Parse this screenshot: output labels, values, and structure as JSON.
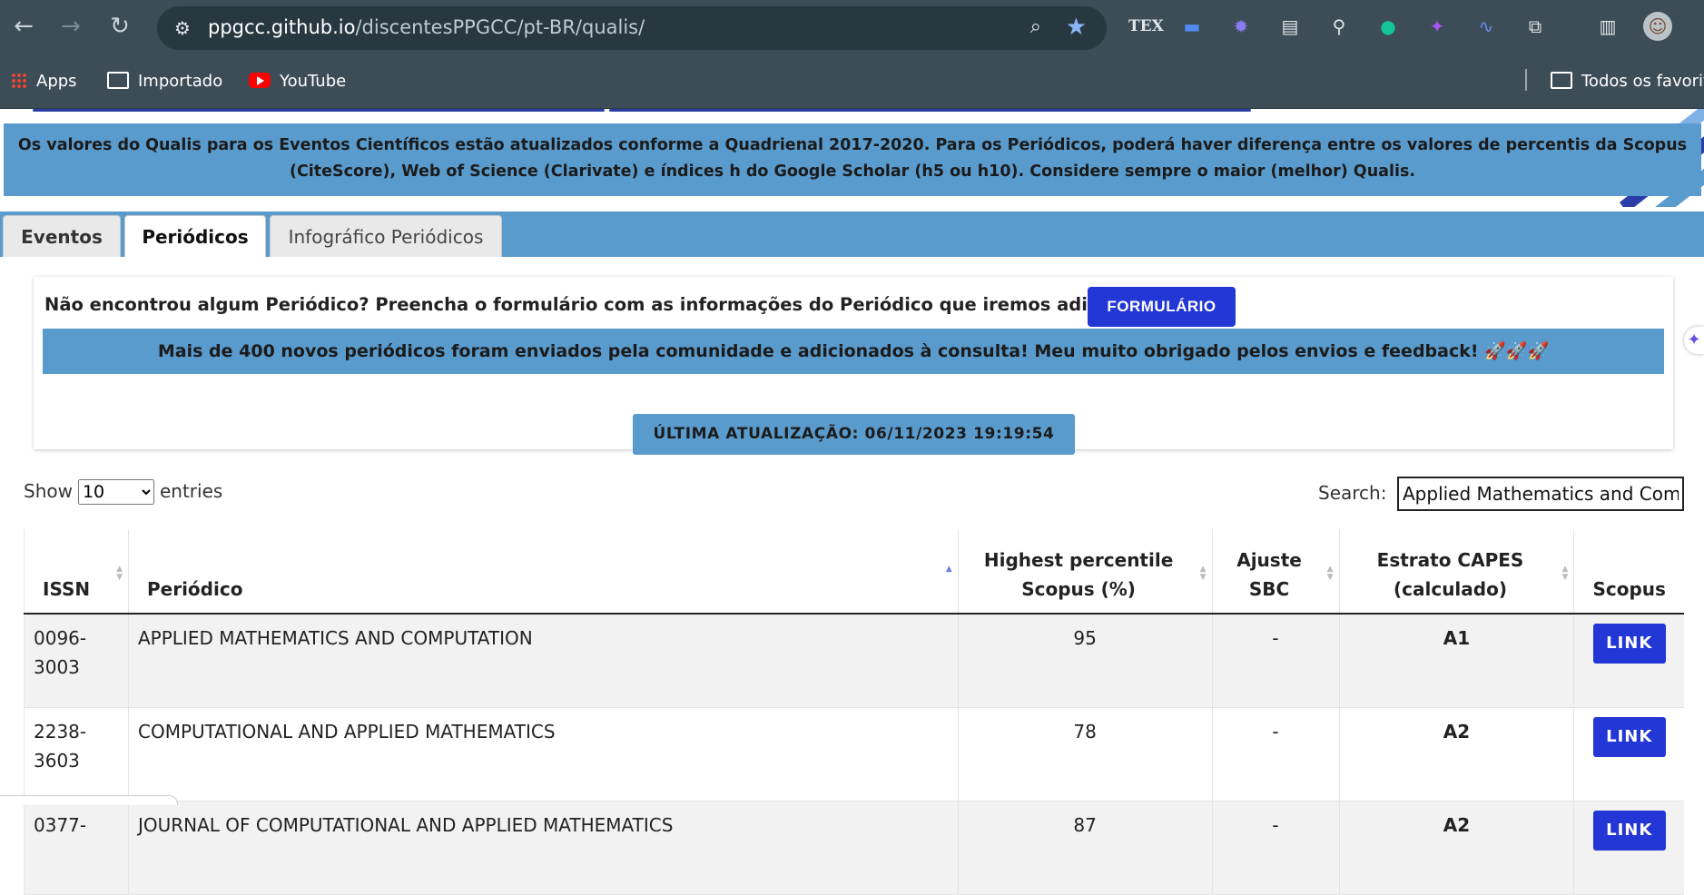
{
  "browser": {
    "url_host": "ppgcc.github.io",
    "url_path": "/discentesPPGCC/pt-BR/qualis/",
    "bookmarks": [
      "Apps",
      "Importado",
      "YouTube"
    ],
    "other_bookmarks": "Todos os favorito"
  },
  "notice": "Os valores do Qualis para os Eventos Científicos estão atualizados conforme a Quadrienal 2017-2020. Para os Periódicos, poderá haver diferença entre os valores de percentis da Scopus (CiteScore), Web of Science (Clarivate) e índices h do Google Scholar (h5 ou h10). Considere sempre o maior (melhor) Qualis.",
  "tabs": [
    "Eventos",
    "Periódicos",
    "Infográfico Periódicos"
  ],
  "active_tab": "Periódicos",
  "form_prompt": "Não encontrou algum Periódico? Preencha o formulário com as informações do Periódico que iremos adicioná-lo:",
  "form_button": "FORMULÁRIO",
  "community_msg": "Mais de 400 novos periódicos foram enviados pela comunidade e adicionados à consulta! Meu muito obrigado pelos envios e feedback! 🚀🚀🚀",
  "last_update": "ÚLTIMA ATUALIZAÇÃO: 06/11/2023 19:19:54",
  "table_controls": {
    "show_label": "Show",
    "entries_value": "10",
    "entries_label": "entries",
    "search_label": "Search:",
    "search_value": "Applied Mathematics and Computation"
  },
  "columns": {
    "issn": "ISSN",
    "periodico": "Periódico",
    "percentile_l1": "Highest percentile",
    "percentile_l2": "Scopus (%)",
    "ajuste_l1": "Ajuste",
    "ajuste_l2": "SBC",
    "estrato_l1": "Estrato CAPES",
    "estrato_l2": "(calculado)",
    "scopus": "Scopus"
  },
  "rows": [
    {
      "issn_a": "0096-",
      "issn_b": "3003",
      "title": "APPLIED MATHEMATICS AND COMPUTATION",
      "percentile": "95",
      "ajuste": "-",
      "estrato": "A1",
      "link": "LINK"
    },
    {
      "issn_a": "2238-",
      "issn_b": "3603",
      "title": "COMPUTATIONAL AND APPLIED MATHEMATICS",
      "percentile": "78",
      "ajuste": "-",
      "estrato": "A2",
      "link": "LINK"
    },
    {
      "issn_a": "0377-",
      "issn_b": "",
      "title": "JOURNAL OF COMPUTATIONAL AND APPLIED MATHEMATICS",
      "percentile": "87",
      "ajuste": "-",
      "estrato": "A2",
      "link": "LINK"
    }
  ],
  "colors": {
    "accent_blue": "#5a9bcd",
    "button_blue": "#2336d6",
    "chrome": "#3c4d57"
  }
}
